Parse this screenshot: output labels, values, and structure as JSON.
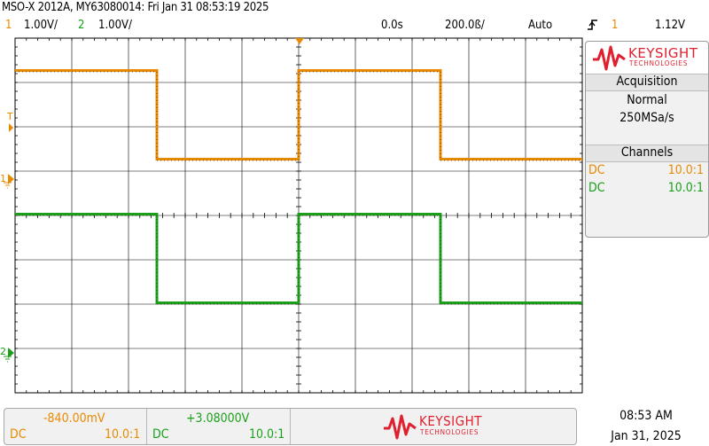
{
  "header": {
    "title": "MSO-X 2012A, MY63080014: Fri Jan 31 08:53:19 2025",
    "ch1_num": "1",
    "ch1_scale": "1.00V/",
    "ch2_num": "2",
    "ch2_scale": "1.00V/",
    "time_position": "0.0s",
    "time_scale": "200.0ß/",
    "trigger_mode": "Auto",
    "trigger_icon": "rising-edge-icon",
    "trigger_source": "1",
    "trigger_level": "1.12V"
  },
  "markers": {
    "trigger_level_marker": "T",
    "ch1_ground_marker": "1",
    "ch2_ground_marker": "2"
  },
  "side_panel": {
    "brand": "KEYSIGHT",
    "brand_sub": "TECHNOLOGIES",
    "acquisition_title": "Acquisition",
    "acq_mode": "Normal",
    "sample_rate": "250MSa/s",
    "channels_title": "Channels",
    "channels": [
      {
        "coupling": "DC",
        "probe": "10.0:1",
        "color": "#e88a00"
      },
      {
        "coupling": "DC",
        "probe": "10.0:1",
        "color": "#1aa01a"
      }
    ]
  },
  "bottom_bar": {
    "ch1_offset": "-840.00mV",
    "ch1_coupling": "DC",
    "ch1_probe": "10.0:1",
    "ch2_offset": "+3.08000V",
    "ch2_coupling": "DC",
    "ch2_probe": "10.0:1",
    "brand": "KEYSIGHT",
    "brand_sub": "TECHNOLOGIES"
  },
  "clock": {
    "time": "08:53 AM",
    "date": "Jan 31, 2025"
  },
  "colors": {
    "ch1": "#e88a00",
    "ch2": "#1aa01a",
    "brand_red": "#e0202e",
    "grid": "#000000"
  },
  "waveforms": [
    {
      "channel": "1",
      "shape": "square",
      "high_divisions_from_top": 0.73,
      "low_divisions_from_top": 2.73,
      "edge_divisions_x": [
        2.5,
        5.0,
        7.5
      ],
      "first_state": "high"
    },
    {
      "channel": "2",
      "shape": "square",
      "high_divisions_from_top": 3.97,
      "low_divisions_from_top": 5.97,
      "edge_divisions_x": [
        2.5,
        5.0,
        7.5
      ],
      "first_state": "high"
    }
  ]
}
